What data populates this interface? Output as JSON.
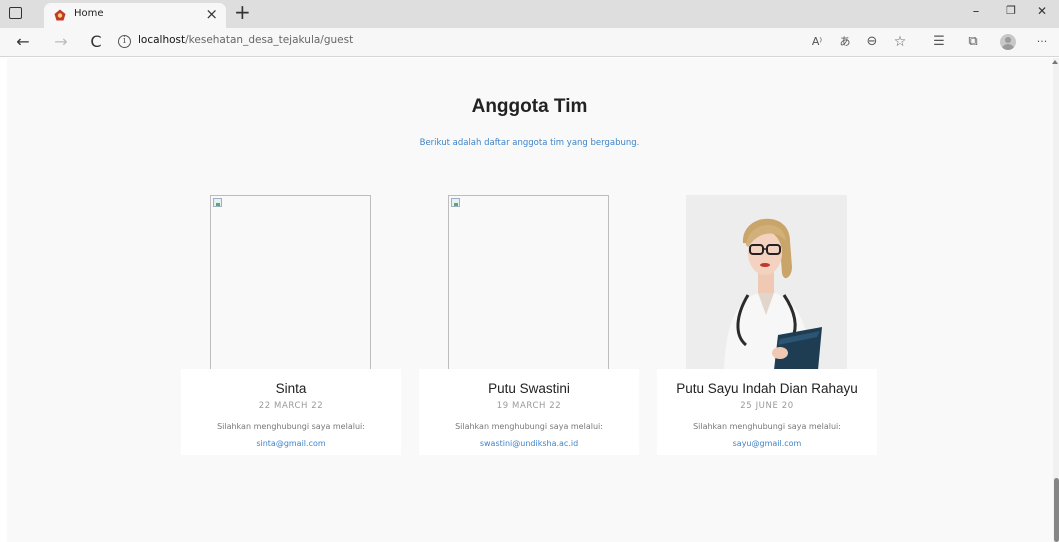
{
  "browser": {
    "tab": {
      "title": "Home",
      "close_glyph": "×"
    },
    "new_tab_glyph": "+",
    "window_controls": {
      "minimize": "–",
      "restore": "❐",
      "close": "✕"
    },
    "nav": {
      "back": "←",
      "forward": "→",
      "refresh": "C"
    },
    "url": {
      "host": "localhost",
      "path": "/kesehatan_desa_tejakula/guest"
    },
    "toolbar_icons": [
      "read-aloud-icon",
      "translate-icon",
      "zoom-icon",
      "favorite-add-icon",
      "favorites-icon",
      "collections-icon",
      "profile-icon",
      "more-icon"
    ],
    "toolbar_glyphs": {
      "read_aloud": "A⁾",
      "translate": "あ",
      "zoom": "⊖",
      "favorite_add": "☆",
      "favorites": "☰",
      "collections": "⧉",
      "more": "···"
    }
  },
  "section": {
    "title": "Anggota Tim",
    "subtitle": "Berikut adalah daftar anggota tim yang bergabung."
  },
  "members": [
    {
      "name": "Sinta",
      "date": "22 MARCH 22",
      "contact_label": "Silahkan menghubungi saya melalui:",
      "email": "sinta@gmail.com",
      "image": "broken"
    },
    {
      "name": "Putu Swastini",
      "date": "19 MARCH 22",
      "contact_label": "Silahkan menghubungi saya melalui:",
      "email": "swastini@undiksha.ac.id",
      "image": "broken"
    },
    {
      "name": "Putu Sayu Indah Dian Rahayu",
      "date": "25 JUNE 20",
      "contact_label": "Silahkan menghubungi saya melalui:",
      "email": "sayu@gmail.com",
      "image": "photo-doctor"
    }
  ],
  "colors": {
    "accent": "#3e84c9",
    "page_bg": "#f9f9f9",
    "card_bg": "#ffffff"
  }
}
